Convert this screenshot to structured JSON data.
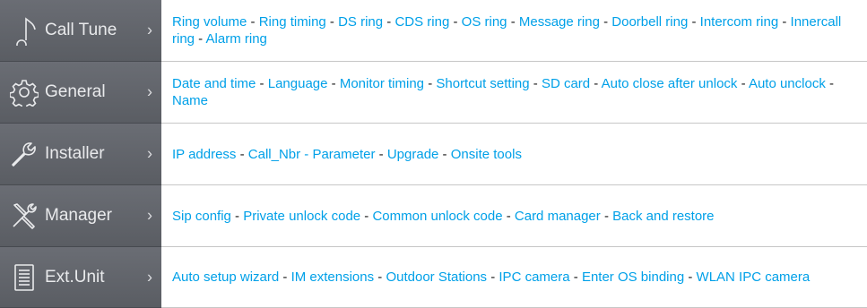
{
  "menu": [
    {
      "label": "Call Tune",
      "icon": "music-note-icon",
      "links": [
        "Ring volume",
        "Ring timing",
        "DS ring",
        "CDS ring",
        "OS ring",
        "Message ring",
        "Doorbell ring",
        "Intercom ring",
        "Innercall ring",
        "Alarm ring"
      ]
    },
    {
      "label": "General",
      "icon": "gear-icon",
      "links": [
        "Date and time",
        "Language",
        "Monitor timing",
        "Shortcut setting",
        "SD card",
        "Auto close after unlock",
        "Auto unclock",
        "Name"
      ]
    },
    {
      "label": "Installer",
      "icon": "wrench-icon",
      "links": [
        "IP address",
        "Call_Nbr - Parameter",
        "Upgrade",
        "Onsite tools"
      ]
    },
    {
      "label": "Manager",
      "icon": "tools-icon",
      "links": [
        "Sip config",
        "Private unlock code",
        "Common unlock code",
        "Card manager",
        "Back and restore"
      ]
    },
    {
      "label": "Ext.Unit",
      "icon": "document-icon",
      "links": [
        "Auto setup wizard",
        "IM extensions",
        "Outdoor Stations",
        "IPC camera",
        "Enter OS binding",
        "WLAN IPC camera"
      ]
    }
  ],
  "separator": " - ",
  "chevron": "›"
}
